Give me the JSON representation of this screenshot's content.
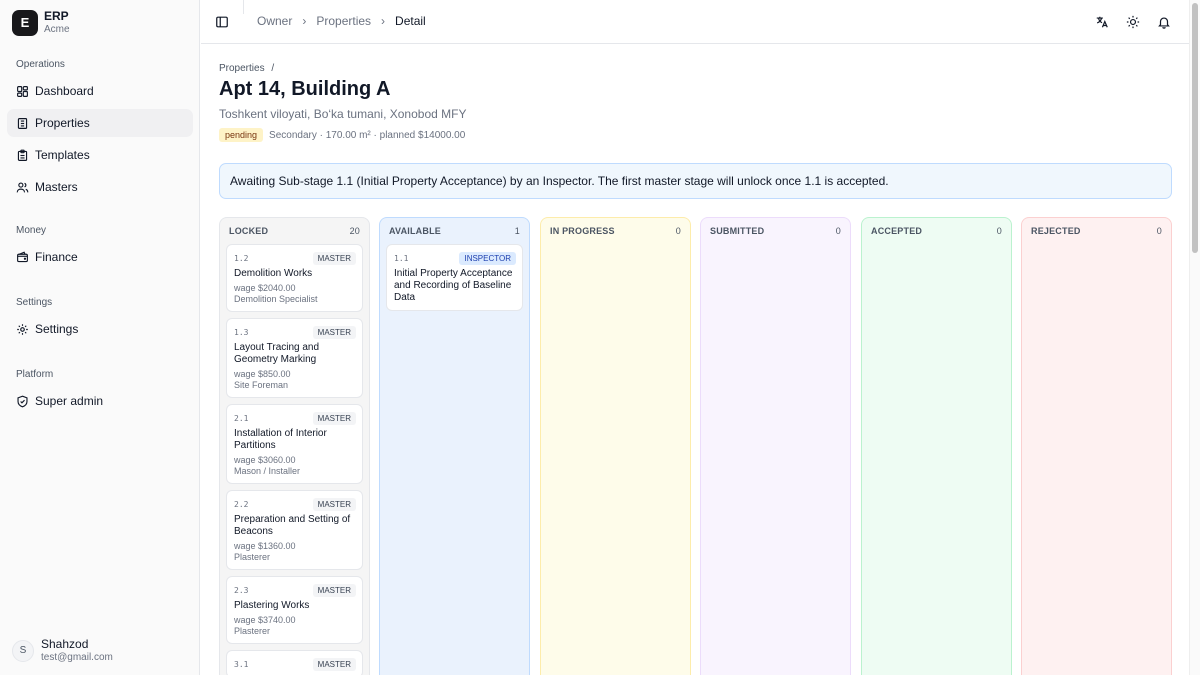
{
  "brand": {
    "initial": "E",
    "name": "ERP",
    "org": "Acme"
  },
  "sidebar": {
    "groups": [
      {
        "label": "Operations",
        "items": [
          {
            "label": "Dashboard",
            "icon": "dashboard-icon"
          },
          {
            "label": "Properties",
            "icon": "building-icon",
            "active": true
          },
          {
            "label": "Templates",
            "icon": "clipboard-icon"
          },
          {
            "label": "Masters",
            "icon": "users-icon"
          }
        ]
      },
      {
        "label": "Money",
        "items": [
          {
            "label": "Finance",
            "icon": "wallet-icon"
          }
        ]
      },
      {
        "label": "Settings",
        "items": [
          {
            "label": "Settings",
            "icon": "gear-icon"
          }
        ]
      },
      {
        "label": "Platform",
        "items": [
          {
            "label": "Super admin",
            "icon": "shield-icon"
          }
        ]
      }
    ]
  },
  "user": {
    "initial": "S",
    "name": "Shahzod",
    "email": "test@gmail.com"
  },
  "header": {
    "breadcrumb": [
      "Owner",
      "Properties",
      "Detail"
    ]
  },
  "page": {
    "sub_crumb": "Properties",
    "sub_crumb_sep": "/",
    "title": "Apt 14, Building A",
    "address": "Toshkent viloyati, Bo‘ka tumani, Xonobod MFY",
    "status": "pending",
    "meta": "Secondary · 170.00 m² · planned $14000.00",
    "notice": "Awaiting Sub-stage 1.1 (Initial Property Acceptance) by an Inspector. The first master stage will unlock once 1.1 is accepted."
  },
  "columns": [
    {
      "title": "LOCKED",
      "count": "20",
      "bg": "#f5f5f5",
      "border": "#e5e7eb",
      "cards": [
        {
          "code": "1.2",
          "role": "MASTER",
          "name": "Demolition Works",
          "wage": "wage $2040.00",
          "spec": "Demolition Specialist"
        },
        {
          "code": "1.3",
          "role": "MASTER",
          "name": "Layout Tracing and Geometry Marking",
          "wage": "wage $850.00",
          "spec": "Site Foreman"
        },
        {
          "code": "2.1",
          "role": "MASTER",
          "name": "Installation of Interior Partitions",
          "wage": "wage $3060.00",
          "spec": "Mason / Installer"
        },
        {
          "code": "2.2",
          "role": "MASTER",
          "name": "Preparation and Setting of Beacons",
          "wage": "wage $1360.00",
          "spec": "Plasterer"
        },
        {
          "code": "2.3",
          "role": "MASTER",
          "name": "Plastering Works",
          "wage": "wage $3740.00",
          "spec": "Plasterer"
        },
        {
          "code": "3.1",
          "role": "MASTER",
          "name": "",
          "wage": "",
          "spec": ""
        }
      ]
    },
    {
      "title": "AVAILABLE",
      "count": "1",
      "bg": "#eaf2fd",
      "border": "#bfdbfe",
      "cards": [
        {
          "code": "1.1",
          "role": "INSPECTOR",
          "name": "Initial Property Acceptance and Recording of Baseline Data",
          "wage": "",
          "spec": ""
        }
      ]
    },
    {
      "title": "IN PROGRESS",
      "count": "0",
      "bg": "#fefcea",
      "border": "#fdecab",
      "cards": []
    },
    {
      "title": "SUBMITTED",
      "count": "0",
      "bg": "#f9f4fe",
      "border": "#ecdcfb",
      "cards": []
    },
    {
      "title": "ACCEPTED",
      "count": "0",
      "bg": "#eefcf3",
      "border": "#bbf2cf",
      "cards": []
    },
    {
      "title": "REJECTED",
      "count": "0",
      "bg": "#fef1f1",
      "border": "#fbd0d0",
      "cards": []
    }
  ]
}
